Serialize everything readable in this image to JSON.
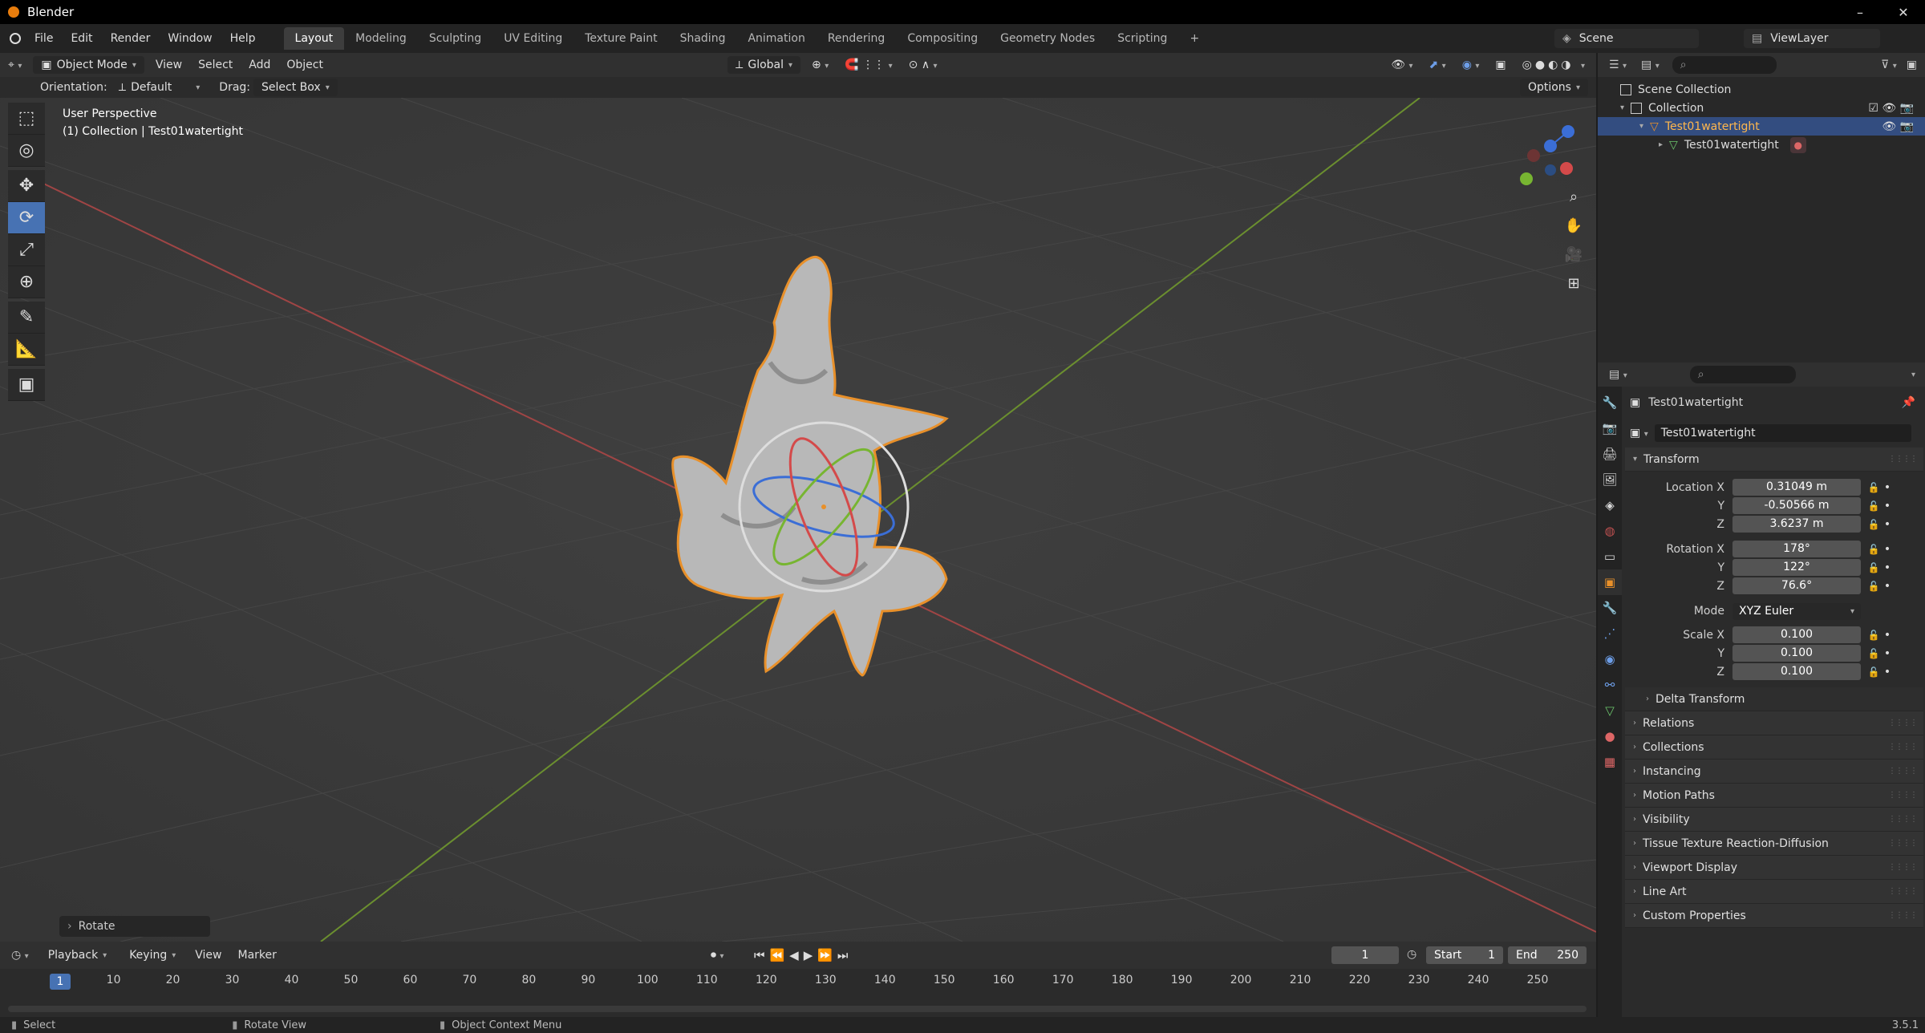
{
  "window": {
    "title": "Blender",
    "controls": [
      "–",
      "▢",
      "✕"
    ]
  },
  "menu": {
    "items": [
      "File",
      "Edit",
      "Render",
      "Window",
      "Help"
    ]
  },
  "workspaces": [
    "Layout",
    "Modeling",
    "Sculpting",
    "UV Editing",
    "Texture Paint",
    "Shading",
    "Animation",
    "Rendering",
    "Compositing",
    "Geometry Nodes",
    "Scripting",
    "+"
  ],
  "scene": {
    "name": "Scene",
    "view_layer": "ViewLayer"
  },
  "viewport_header": {
    "mode": "Object Mode",
    "menus": [
      "View",
      "Select",
      "Add",
      "Object"
    ],
    "orientation_global": "Global",
    "orientation_label": "Orientation:",
    "orientation_value": "Default",
    "drag_label": "Drag:",
    "drag_value": "Select Box",
    "options": "Options"
  },
  "viewport": {
    "perspective": "User Perspective",
    "collection_line": "(1) Collection | Test01watertight",
    "gizmo_axes": [
      "X",
      "Y",
      "Z"
    ],
    "last_op": "Rotate"
  },
  "outliner": {
    "rows": [
      {
        "label": "Scene Collection",
        "indent": 0
      },
      {
        "label": "Collection",
        "indent": 1
      },
      {
        "label": "Test01watertight",
        "indent": 2,
        "selected": true
      },
      {
        "label": "Test01watertight",
        "indent": 3
      }
    ]
  },
  "properties": {
    "object_name": "Test01watertight",
    "data_name": "Test01watertight",
    "transform": {
      "header": "Transform",
      "location_label": "Location X",
      "location": [
        "0.31049 m",
        "-0.50566 m",
        "3.6237 m"
      ],
      "rotation_label": "Rotation X",
      "rotation": [
        "178°",
        "122°",
        "76.6°"
      ],
      "mode_label": "Mode",
      "mode": "XYZ Euler",
      "scale_label": "Scale X",
      "scale": [
        "0.100",
        "0.100",
        "0.100"
      ],
      "y": "Y",
      "z": "Z"
    },
    "subpanels": [
      "Delta Transform"
    ],
    "panels": [
      "Relations",
      "Collections",
      "Instancing",
      "Motion Paths",
      "Visibility",
      "Tissue Texture Reaction-Diffusion",
      "Viewport Display",
      "Line Art",
      "Custom Properties"
    ]
  },
  "timeline": {
    "menus": [
      "Playback",
      "Keying",
      "View",
      "Marker"
    ],
    "current_frame": "1",
    "start_label": "Start",
    "start": "1",
    "end_label": "End",
    "end": "250",
    "ticks": [
      "1",
      "10",
      "20",
      "30",
      "40",
      "50",
      "60",
      "70",
      "80",
      "90",
      "100",
      "110",
      "120",
      "130",
      "140",
      "150",
      "160",
      "170",
      "180",
      "190",
      "200",
      "210",
      "220",
      "230",
      "240",
      "250"
    ]
  },
  "status": {
    "select": "Select",
    "rotate_view": "Rotate View",
    "context_menu": "Object Context Menu",
    "version": "3.5.1"
  }
}
